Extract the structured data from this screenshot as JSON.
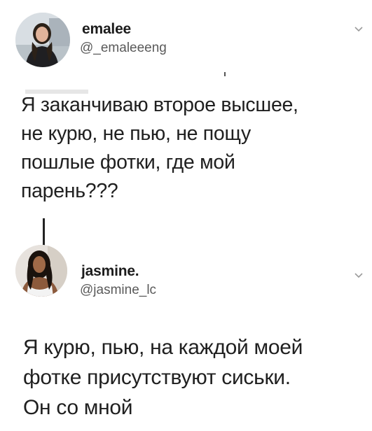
{
  "tweets": [
    {
      "name": "emalee",
      "handle": "@_emaleeeng",
      "text": "Я заканчиваю второе высшее,\nне курю, не пью, не пощу\nпошлые фотки, где мой\nпарень???"
    },
    {
      "name": "jasmine.",
      "handle": "@jasmine_lc",
      "text": "Я курю, пью, на каждой моей\nфотке присутствуют сиськи.\nОн со мной"
    }
  ],
  "icons": {
    "menu": "chevron-down-icon",
    "avatar1": "profile-photo",
    "avatar2": "profile-photo"
  },
  "colors": {
    "text": "#202020",
    "handle": "#5a5a5a",
    "background": "#ffffff"
  }
}
